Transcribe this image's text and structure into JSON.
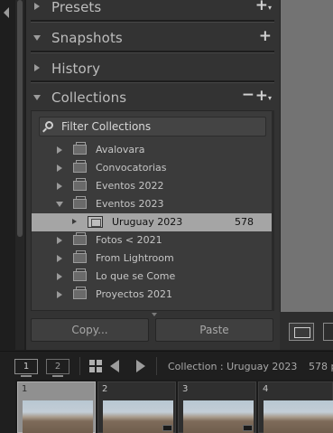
{
  "panel": {
    "sections": {
      "presets": {
        "title": "Presets",
        "add": "+"
      },
      "snapshots": {
        "title": "Snapshots",
        "add": "+"
      },
      "history": {
        "title": "History"
      },
      "collections": {
        "title": "Collections",
        "remove": "−",
        "add": "+"
      }
    },
    "filter": {
      "placeholder": "Filter Collections"
    },
    "collections": [
      {
        "name": "Avalovara",
        "expanded": false
      },
      {
        "name": "Convocatorias",
        "expanded": false
      },
      {
        "name": "Eventos 2022",
        "expanded": false
      },
      {
        "name": "Eventos 2023",
        "expanded": true
      },
      {
        "name": "Uruguay 2023",
        "count": "578",
        "selected": true
      },
      {
        "name": "Fotos < 2021",
        "expanded": false
      },
      {
        "name": "From Lightroom",
        "expanded": false
      },
      {
        "name": "Lo que se Come",
        "expanded": false
      },
      {
        "name": "Proyectos 2021",
        "expanded": false
      }
    ],
    "buttons": {
      "copy": "Copy...",
      "paste": "Paste"
    }
  },
  "toolbar": {
    "monitor_1": "1",
    "monitor_2": "2",
    "source": "Collection : Uruguay 2023",
    "count": "578 p"
  },
  "filmstrip": {
    "cells": [
      {
        "number": "1",
        "active": true
      },
      {
        "number": "2",
        "active": false
      },
      {
        "number": "3",
        "active": false
      },
      {
        "number": "4",
        "active": false
      }
    ]
  },
  "colors": {
    "panel_bg": "#333333",
    "selected_row": "#a5a5a5",
    "window_bg": "#1f1f1f"
  }
}
